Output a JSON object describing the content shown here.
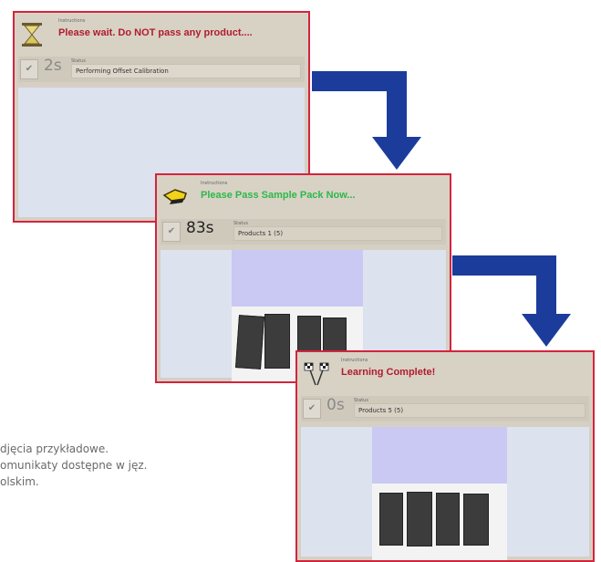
{
  "panels": [
    {
      "small_label": "Instructions",
      "message": "Please wait. Do NOT pass any product....",
      "message_color": "#b01c2e",
      "seconds": "2s",
      "status_label": "Status",
      "status": "Performing Offset Calibration",
      "icon": "hourglass-icon"
    },
    {
      "small_label": "Instructions",
      "message": "Please Pass Sample Pack Now...",
      "message_color": "#2db84a",
      "seconds": "83s",
      "status_label": "Status",
      "status": "Products 1 (5)",
      "icon": "hand-pointing-icon"
    },
    {
      "small_label": "Instructions",
      "message": "Learning Complete!",
      "message_color": "#b01c2e",
      "seconds": "0s",
      "status_label": "Status",
      "status": "Products 5 (5)",
      "icon": "checkered-flags-icon"
    }
  ],
  "note_lines": [
    "djęcia przykładowe.",
    "omunikaty dostępne w jęz.",
    "olskim."
  ],
  "colors": {
    "frame_border": "#d4243c",
    "arrow": "#1c3c9c",
    "panel_bg": "#d6d0c4",
    "view_bg": "#dde2ef"
  }
}
